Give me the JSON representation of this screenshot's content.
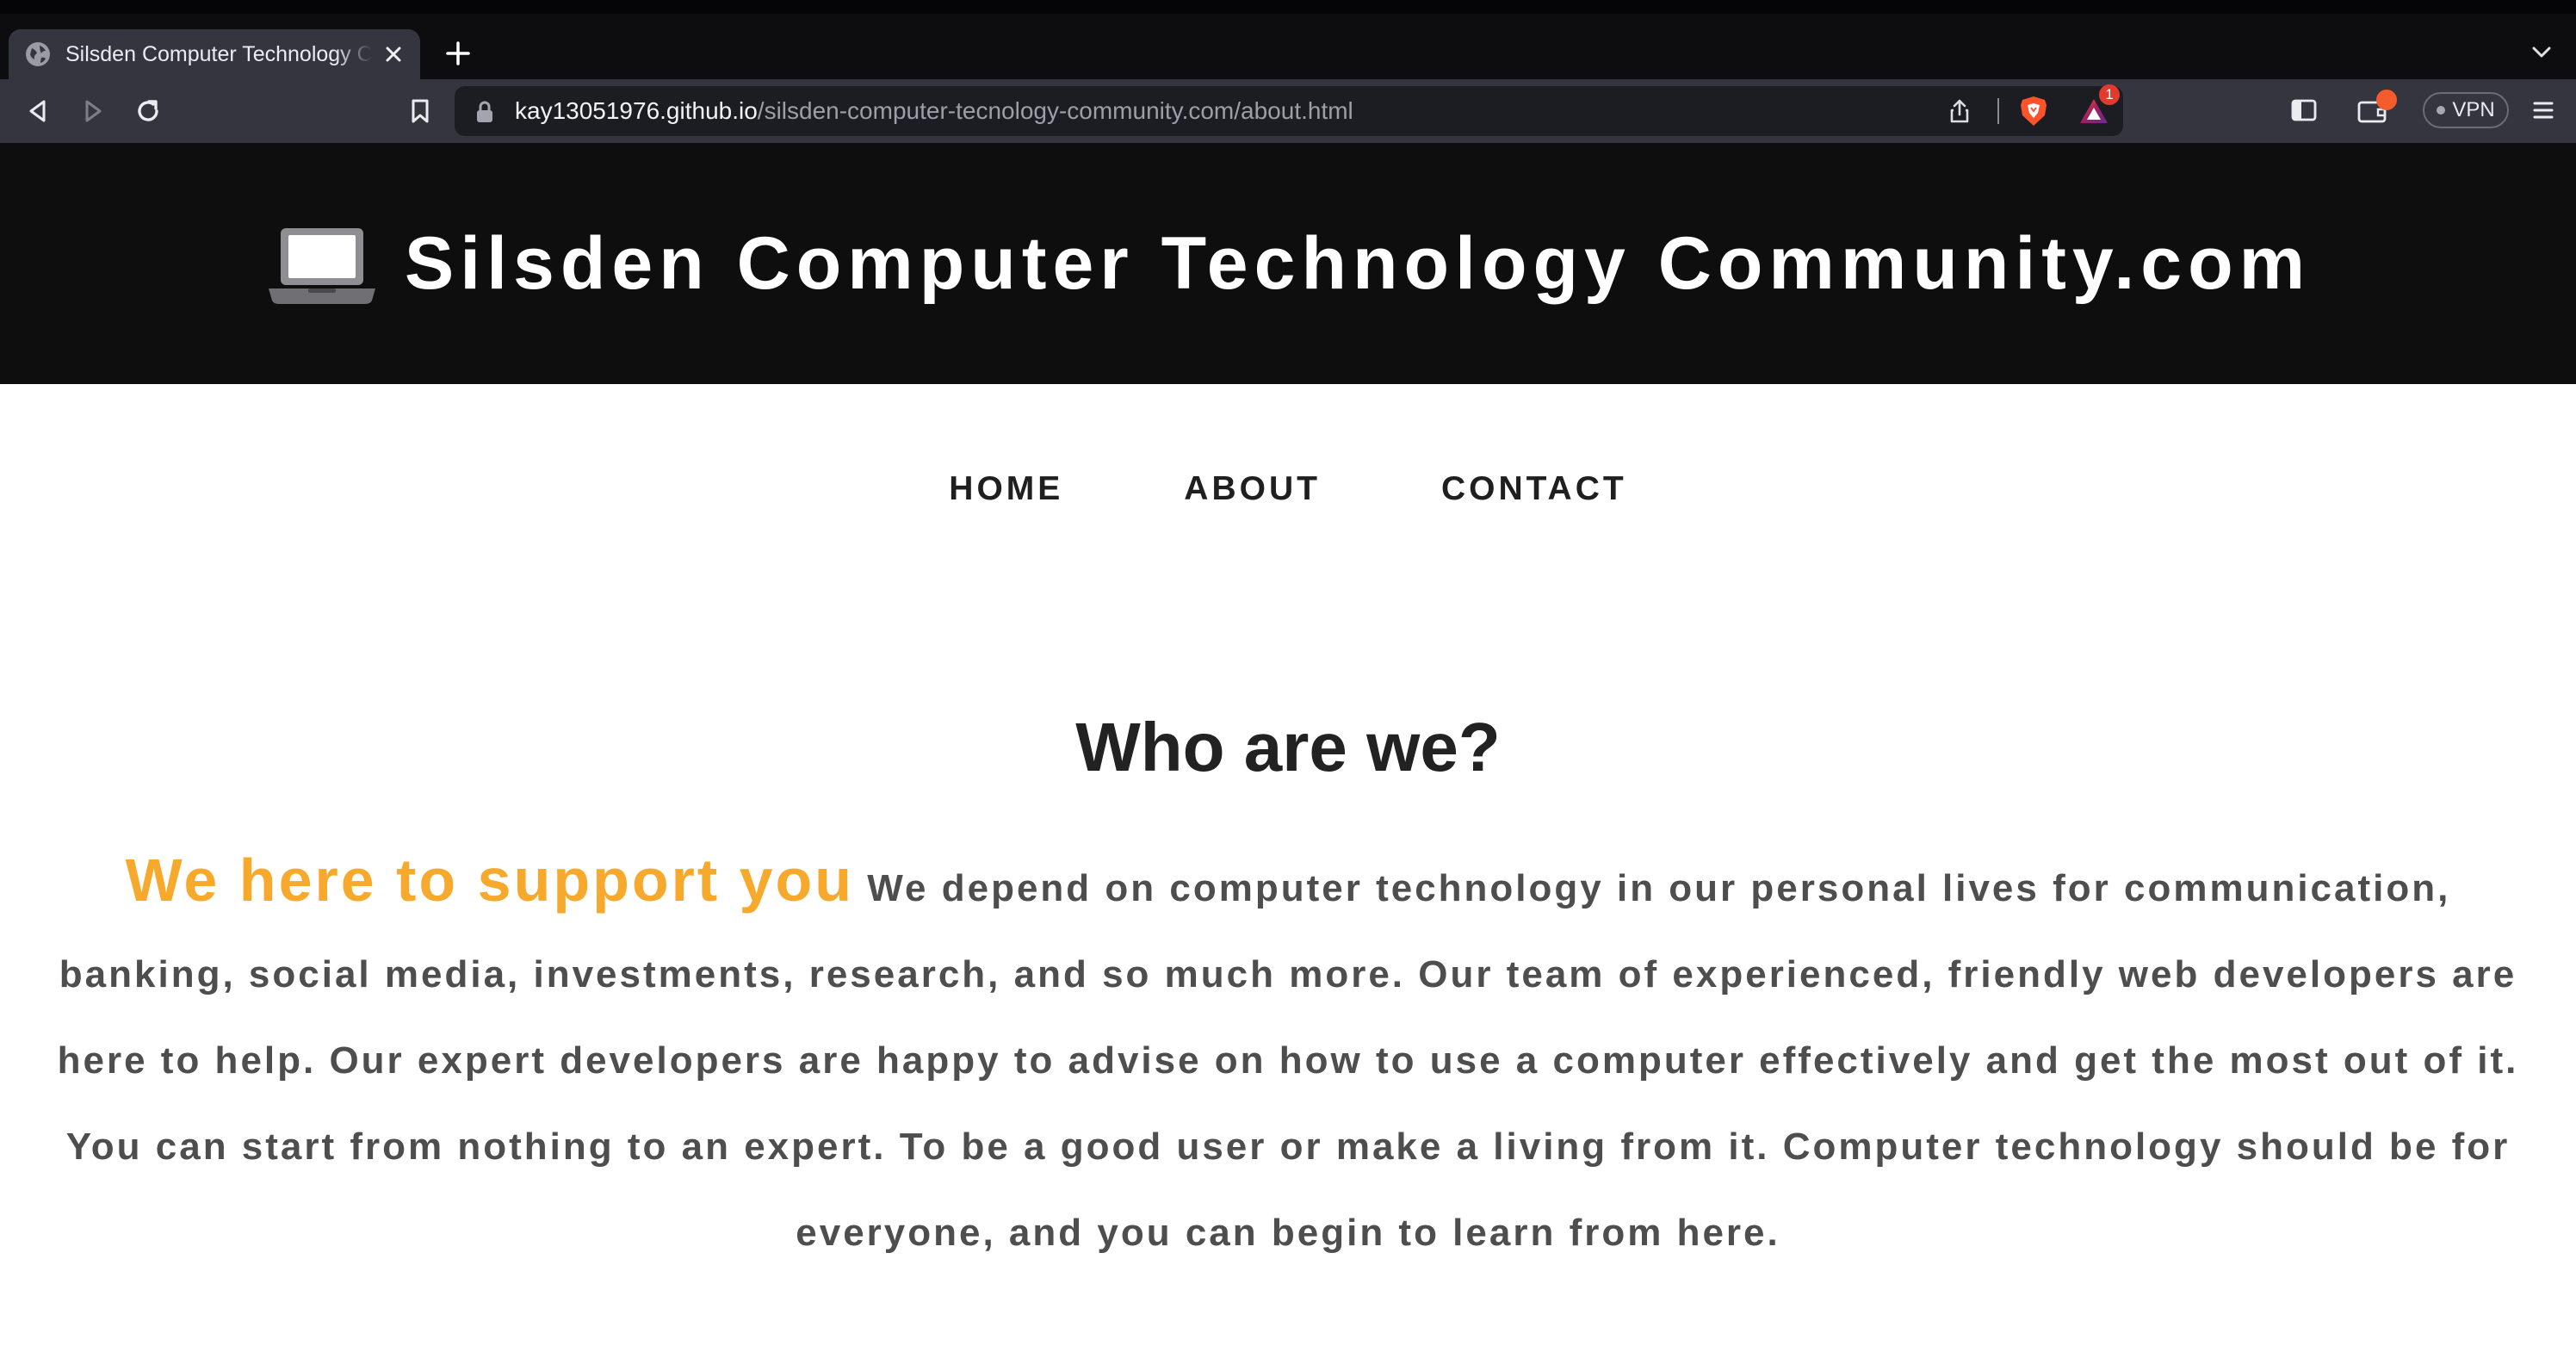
{
  "browser": {
    "tab_title": "Silsden Computer Technology Community.com",
    "url_host": "kay13051976.github.io",
    "url_path": "/silsden-computer-tecnology-community.com/about.html",
    "rewards_badge": "1",
    "vpn_label": "VPN",
    "icons": [
      "globe-icon",
      "close-icon",
      "plus-icon",
      "chevron-down-icon",
      "back-icon",
      "forward-icon",
      "reload-icon",
      "bookmark-icon",
      "lock-icon",
      "share-icon",
      "brave-shields-icon",
      "brave-rewards-icon",
      "sidebar-icon",
      "wallet-icon",
      "menu-icon"
    ]
  },
  "header": {
    "title": "Silsden Computer Technology Community.com",
    "logo_icon": "laptop-icon"
  },
  "nav": {
    "items": [
      {
        "label": "HOME"
      },
      {
        "label": "ABOUT"
      },
      {
        "label": "CONTACT"
      }
    ]
  },
  "main": {
    "heading": "Who are we?",
    "highlight": "We here to support you",
    "body": "We depend on computer technology in our personal lives for communication, banking, social media, investments, research, and so much more. Our team of experienced, friendly web developers are here to help. Our expert developers are happy to advise on how to use a computer effectively and get the most out of it. You can start from nothing to an expert. To be a good user or make a living from it. Computer technology should be for everyone, and you can begin to learn from here."
  },
  "colors": {
    "header_bg": "#0e0e0f",
    "accent": "#f6a92c",
    "heading": "#222222",
    "body_text": "#4e4e4e",
    "chrome_toolbar": "#34353f"
  }
}
